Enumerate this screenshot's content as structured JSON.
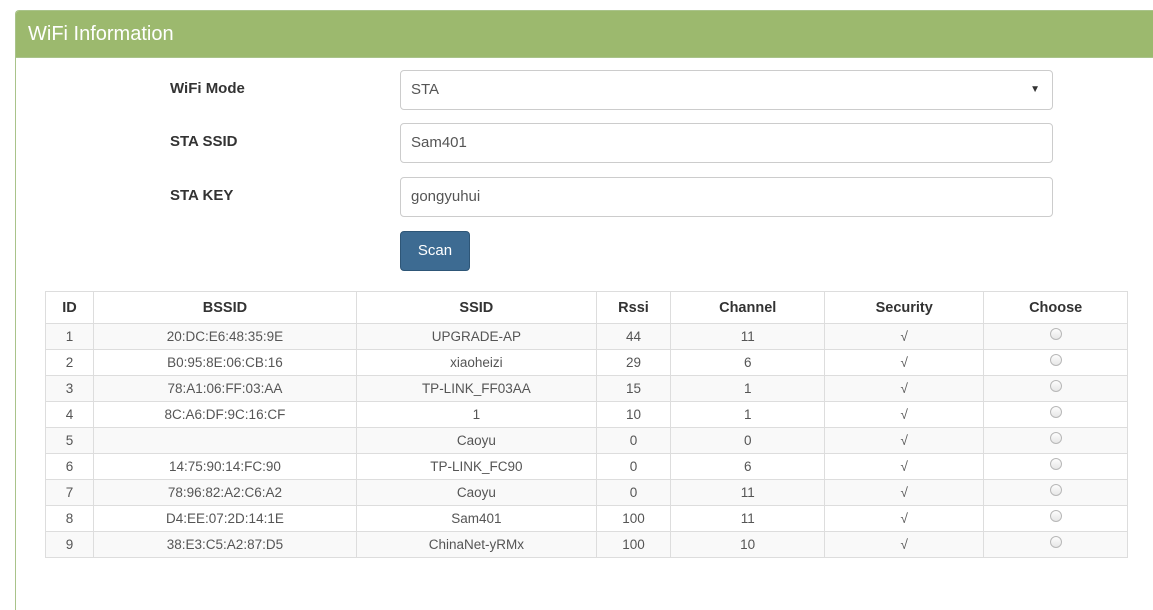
{
  "panel": {
    "title": "WiFi Information"
  },
  "form": {
    "mode_label": "WiFi Mode",
    "mode_value": "STA",
    "ssid_label": "STA SSID",
    "ssid_value": "Sam401",
    "key_label": "STA KEY",
    "key_value": "gongyuhui",
    "scan_label": "Scan"
  },
  "table": {
    "headers": [
      "ID",
      "BSSID",
      "SSID",
      "Rssi",
      "Channel",
      "Security",
      "Choose"
    ],
    "rows": [
      {
        "id": "1",
        "bssid": "20:DC:E6:48:35:9E",
        "ssid": "UPGRADE-AP",
        "rssi": "44",
        "channel": "11",
        "security": "√"
      },
      {
        "id": "2",
        "bssid": "B0:95:8E:06:CB:16",
        "ssid": "xiaoheizi",
        "rssi": "29",
        "channel": "6",
        "security": "√"
      },
      {
        "id": "3",
        "bssid": "78:A1:06:FF:03:AA",
        "ssid": "TP-LINK_FF03AA",
        "rssi": "15",
        "channel": "1",
        "security": "√"
      },
      {
        "id": "4",
        "bssid": "8C:A6:DF:9C:16:CF",
        "ssid": "1",
        "rssi": "10",
        "channel": "1",
        "security": "√"
      },
      {
        "id": "5",
        "bssid": "",
        "ssid": "Caoyu",
        "rssi": "0",
        "channel": "0",
        "security": "√"
      },
      {
        "id": "6",
        "bssid": "14:75:90:14:FC:90",
        "ssid": "TP-LINK_FC90",
        "rssi": "0",
        "channel": "6",
        "security": "√"
      },
      {
        "id": "7",
        "bssid": "78:96:82:A2:C6:A2",
        "ssid": "Caoyu",
        "rssi": "0",
        "channel": "11",
        "security": "√"
      },
      {
        "id": "8",
        "bssid": "D4:EE:07:2D:14:1E",
        "ssid": "Sam401",
        "rssi": "100",
        "channel": "11",
        "security": "√"
      },
      {
        "id": "9",
        "bssid": "38:E3:C5:A2:87:D5",
        "ssid": "ChinaNet-yRMx",
        "rssi": "100",
        "channel": "10",
        "security": "√"
      }
    ]
  }
}
